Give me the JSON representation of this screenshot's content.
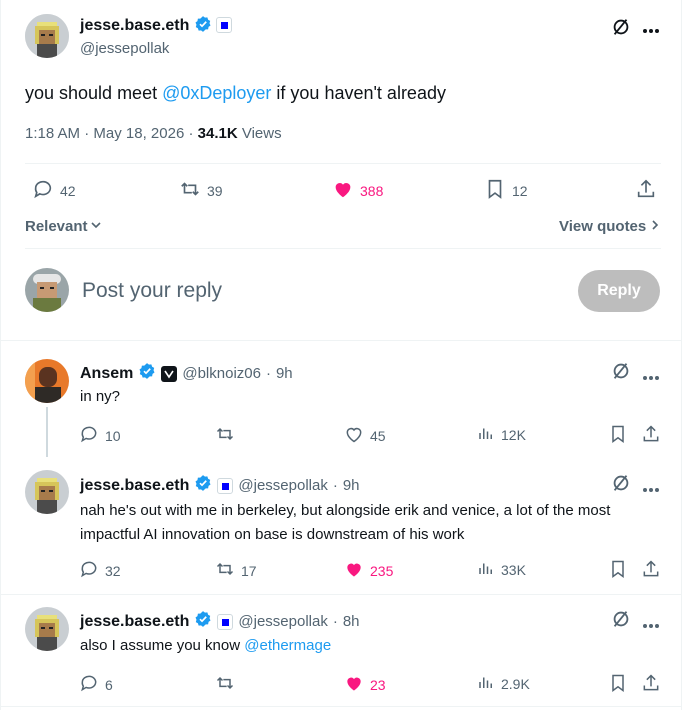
{
  "main_tweet": {
    "author_name": "jesse.base.eth",
    "author_handle": "@jessepollak",
    "text_before": "you should meet ",
    "mention": "@0xDeployer",
    "text_after": " if you haven't already",
    "time": "1:18 AM",
    "sep1": "·",
    "date": "May 18, 2026",
    "sep2": "·",
    "views_count": "34.1K",
    "views_label": "Views",
    "replies": "42",
    "reposts": "39",
    "likes": "388",
    "bookmarks": "12"
  },
  "sort": {
    "label": "Relevant",
    "view_quotes": "View quotes"
  },
  "composer": {
    "placeholder": "Post your reply",
    "button": "Reply"
  },
  "replies": [
    {
      "author_name": "Ansem",
      "author_handle": "@blknoiz06",
      "time": "9h",
      "text": "in ny?",
      "replies": "10",
      "reposts": "",
      "likes": "45",
      "views": "12K"
    },
    {
      "author_name": "jesse.base.eth",
      "author_handle": "@jessepollak",
      "time": "9h",
      "text": "nah he's out with me in berkeley, but alongside erik and venice, a lot of the most impactful AI innovation on base is downstream of his work",
      "replies": "32",
      "reposts": "17",
      "likes": "235",
      "views": "33K"
    },
    {
      "author_name": "jesse.base.eth",
      "author_handle": "@jessepollak",
      "time": "8h",
      "text_before": "also I assume you know ",
      "mention": "@ethermage",
      "replies": "6",
      "reposts": "",
      "likes": "23",
      "views": "2.9K"
    }
  ],
  "icons": [
    "grok-icon",
    "more-icon",
    "verified-icon",
    "reply-icon",
    "repost-icon",
    "like-icon",
    "bookmark-icon",
    "share-icon",
    "views-icon",
    "chevron-down-icon",
    "chevron-right-icon"
  ],
  "colors": {
    "accent": "#1d9bf0",
    "like": "#f91880",
    "muted": "#536471",
    "divider": "#eff3f4"
  }
}
